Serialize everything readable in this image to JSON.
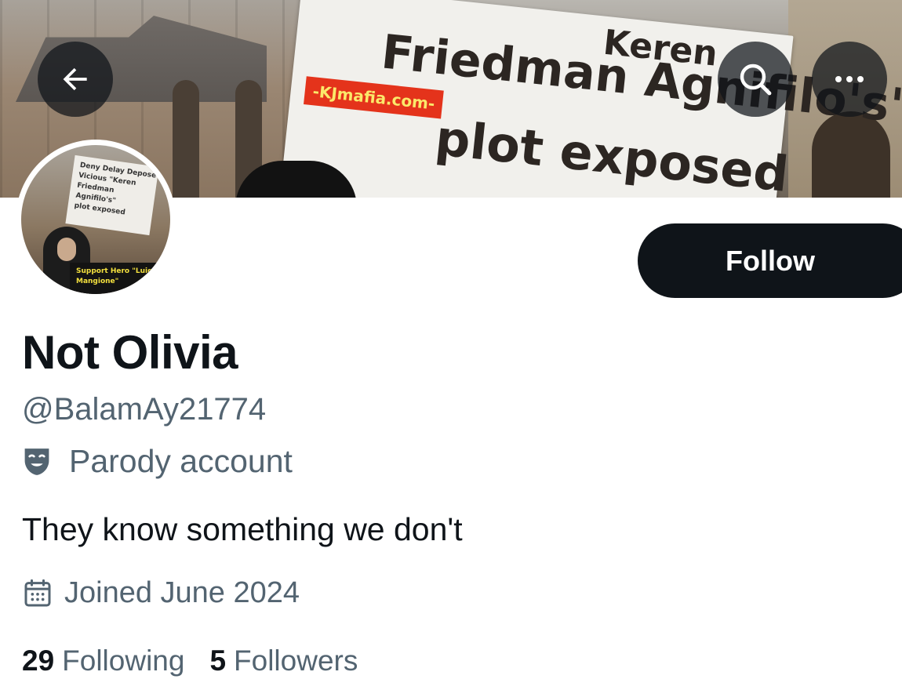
{
  "banner": {
    "sign_line1": "Keren",
    "sign_line2": "Friedman Agnifilo's\"",
    "sign_line3": "plot exposed",
    "sign_tag": "-KJmafia.com-"
  },
  "avatar": {
    "sign_text": "Deny Delay Depose\nVicious \"Keren\nFriedman Agnifilo's\"\nplot exposed",
    "banner_text": "Support Hero \"Luigi\nMangione\""
  },
  "actions": {
    "follow_label": "Follow"
  },
  "profile": {
    "name": "Not Olivia",
    "handle": "@BalamAy21774",
    "label": "Parody account",
    "bio": "They know something we don't",
    "joined": "Joined June 2024"
  },
  "stats": {
    "following_count": "29",
    "following_label": "Following",
    "followers_count": "5",
    "followers_label": "Followers"
  },
  "icons": {
    "back": "arrow-left-icon",
    "search": "search-icon",
    "more": "more-horizontal-icon",
    "parody": "theater-mask-icon",
    "calendar": "calendar-icon"
  },
  "colors": {
    "text_primary": "#0f1419",
    "text_secondary": "#536471",
    "button_dark": "#0f1419"
  }
}
